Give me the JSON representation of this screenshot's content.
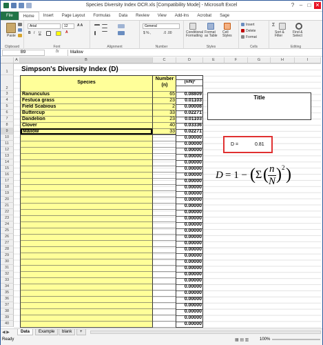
{
  "window": {
    "title": "Species Diversity Index OCR.xls  [Compatibility Mode] - Microsoft Excel"
  },
  "tabs": [
    "File",
    "Home",
    "Insert",
    "Page Layout",
    "Formulas",
    "Data",
    "Review",
    "View",
    "Add-Ins",
    "Acrobat",
    "Sage"
  ],
  "ribbon": {
    "clipboard": "Clipboard",
    "font_label": "Font",
    "alignment": "Alignment",
    "number": "Number",
    "styles": "Styles",
    "cells": "Cells",
    "editing": "Editing",
    "paste": "Paste",
    "font_name": "Arial",
    "font_size": "12",
    "number_format": "General",
    "cond_format": "Conditional Formatting",
    "format_table": "Format as Table",
    "cell_styles": "Cell Styles",
    "insert": "Insert",
    "delete": "Delete",
    "format": "Format",
    "sort": "Sort & Filter",
    "find": "Find & Select"
  },
  "formula_bar": {
    "name_box": "B9",
    "fx": "fx",
    "value": "Mallow"
  },
  "columns": [
    "A",
    "B",
    "C",
    "D",
    "E",
    "F",
    "G",
    "H",
    "I"
  ],
  "sheet": {
    "title": "Simpson's Diversity Index (D)",
    "hdr_species": "Species",
    "hdr_number": "Number (n)",
    "hdr_ratio": "(n/N)²",
    "rows": [
      {
        "species": "Ranunculus",
        "n": "65",
        "r": "0.08809"
      },
      {
        "species": "Festuca grass",
        "n": "23",
        "r": "0.01103"
      },
      {
        "species": "Field Scabious",
        "n": "2",
        "r": "0.00008"
      },
      {
        "species": "Buttercup",
        "n": "33",
        "r": "0.02271"
      },
      {
        "species": "Dandelion",
        "n": "23",
        "r": "0.01103"
      },
      {
        "species": "Clover",
        "n": "40",
        "r": "0.03336"
      },
      {
        "species": "Mallow",
        "n": "33",
        "r": "0.02271"
      }
    ],
    "zero": "0.00000",
    "title_box": "Title",
    "d_label": "D =",
    "d_value": "0.81",
    "formula_D": "D",
    "formula_eq": "= 1 −",
    "formula_sigma": "Σ",
    "formula_n": "n",
    "formula_N": "N",
    "formula_exp": "2"
  },
  "row_numbers": [
    "1",
    "2",
    "3",
    "4",
    "5",
    "6",
    "7",
    "8",
    "9",
    "10",
    "11",
    "12",
    "13",
    "14",
    "15",
    "16",
    "17",
    "18",
    "19",
    "20",
    "21",
    "22",
    "23",
    "24",
    "25",
    "26",
    "27",
    "28",
    "29",
    "30",
    "31",
    "32",
    "33",
    "34",
    "35",
    "36",
    "37",
    "38",
    "39",
    "40",
    "41"
  ],
  "sheet_tabs": [
    "Data",
    "Example",
    "blank"
  ],
  "status": {
    "ready": "Ready",
    "zoom": "100%"
  }
}
